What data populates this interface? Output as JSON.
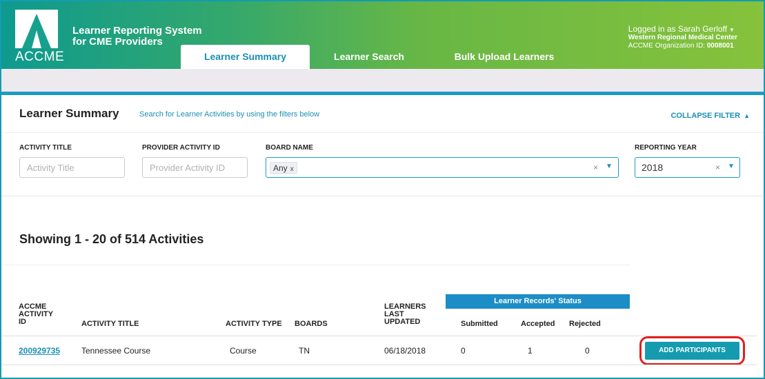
{
  "header": {
    "logo_text": "ACCME",
    "app_title_line1": "Learner Reporting System",
    "app_title_line2": "for CME Providers",
    "tabs": [
      {
        "label": "Learner Summary",
        "active": true
      },
      {
        "label": "Learner Search",
        "active": false
      },
      {
        "label": "Bulk Upload Learners",
        "active": false
      }
    ],
    "user": {
      "logged_in": "Logged in as Sarah Gerloff",
      "organization": "Western Regional Medical Center",
      "org_id_label": "ACCME Organization ID:",
      "org_id": "0008001"
    }
  },
  "filter": {
    "title": "Learner Summary",
    "subtitle": "Search for Learner Activities by using the filters below",
    "collapse_label": "COLLAPSE FILTER",
    "activity_title": {
      "label": "ACTIVITY TITLE",
      "placeholder": "Activity Title",
      "value": ""
    },
    "provider_activity_id": {
      "label": "PROVIDER ACTIVITY ID",
      "placeholder": "Provider Activity ID",
      "value": ""
    },
    "board_name": {
      "label": "BOARD NAME",
      "chip": "Any",
      "chip_remove": "x",
      "clear": "×"
    },
    "reporting_year": {
      "label": "REPORTING YEAR",
      "value": "2018",
      "clear": "×"
    }
  },
  "results": {
    "showing": "Showing 1 - 20 of 514 Activities"
  },
  "table": {
    "headers": {
      "accme_line1": "ACCME",
      "accme_line2": "ACTIVITY",
      "accme_line3": "ID",
      "activity_title": "ACTIVITY TITLE",
      "activity_type": "ACTIVITY TYPE",
      "boards": "BOARDS",
      "learners_line1": "LEARNERS",
      "learners_line2": "LAST",
      "learners_line3": "UPDATED",
      "status_group": "Learner Records' Status",
      "submitted": "Submitted",
      "accepted": "Accepted",
      "rejected": "Rejected"
    },
    "rows": [
      {
        "accme_activity_id": "200929735",
        "activity_title": "Tennessee Course",
        "activity_type": "Course",
        "boards": "TN",
        "last_updated": "06/18/2018",
        "submitted": "0",
        "accepted": "1",
        "rejected": "0",
        "action_label": "ADD PARTICIPANTS"
      }
    ]
  },
  "colors": {
    "accent": "#1a8fb5",
    "button": "#159bb0",
    "status_header": "#1c8dc7",
    "highlight": "#e0201b"
  },
  "icons": {
    "user_menu": "caret-down-icon",
    "collapse": "triangle-up-icon",
    "select_caret": "caret-down-icon",
    "select_clear": "close-icon"
  }
}
